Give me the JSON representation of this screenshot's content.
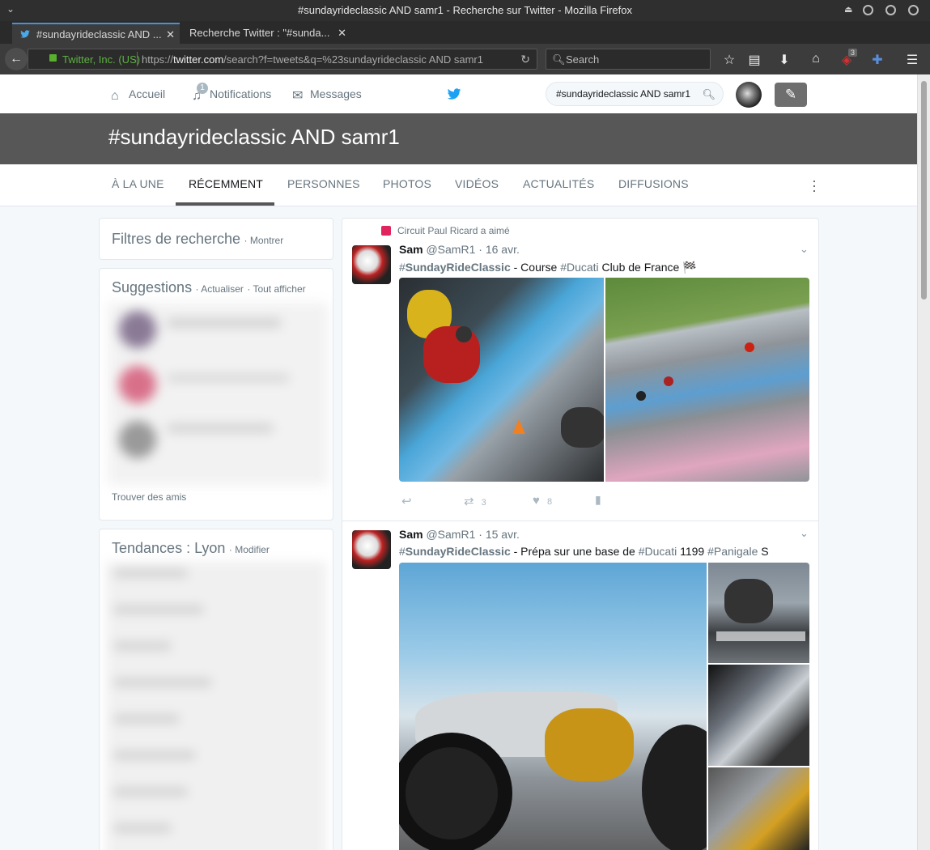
{
  "window": {
    "title": "#sundayrideclassic AND samr1 - Recherche sur Twitter - Mozilla Firefox"
  },
  "tabs": [
    {
      "label": "#sundayrideclassic AND ...",
      "close": "✕"
    },
    {
      "label": "Recherche Twitter : \"#sunda...",
      "close": "✕"
    }
  ],
  "new_tab": "+",
  "nav": {
    "identity": "Twitter, Inc. (US)",
    "url_prefix": "https://",
    "url_domain": "twitter.com",
    "url_rest": "/search?f=tweets&q=%23sundayrideclassic AND samr1",
    "search_placeholder": "Search",
    "ublock_badge": "3"
  },
  "twitter_nav": {
    "home": "Accueil",
    "notifications": "Notifications",
    "notif_count": "1",
    "messages": "Messages",
    "search_value": "#sundayrideclassic AND samr1"
  },
  "hero_title": "#sundayrideclassic AND samr1",
  "search_tabs": [
    "À LA UNE",
    "RÉCEMMENT",
    "PERSONNES",
    "PHOTOS",
    "VIDÉOS",
    "ACTUALITÉS",
    "DIFFUSIONS"
  ],
  "filters": {
    "title": "Filtres de recherche",
    "show": "· Montrer"
  },
  "suggestions": {
    "title": "Suggestions",
    "refresh": "· Actualiser",
    "view_all": "· Tout afficher",
    "find_friends": "Trouver des amis"
  },
  "trends": {
    "title": "Tendances : Lyon",
    "modify": "· Modifier"
  },
  "tweets": [
    {
      "context": "Circuit Paul Ricard a aimé",
      "name": "Sam",
      "handle": "@SamR1",
      "date": "· 16 avr.",
      "text": {
        "h1": "#",
        "b1": "SundayRideClassic",
        "t1": " - Course ",
        "h2": "#Ducati",
        "t2": " Club de France 🏁"
      },
      "replies": "",
      "retweets": "3",
      "likes": "8"
    },
    {
      "name": "Sam",
      "handle": "@SamR1",
      "date": "· 15 avr.",
      "text": {
        "h1": "#",
        "b1": "SundayRideClassic",
        "t1": " - Prépa sur une base de ",
        "h2": "#Ducati",
        "t2": " 1199 ",
        "h3": "#Panigale",
        "t3": " S"
      }
    }
  ]
}
